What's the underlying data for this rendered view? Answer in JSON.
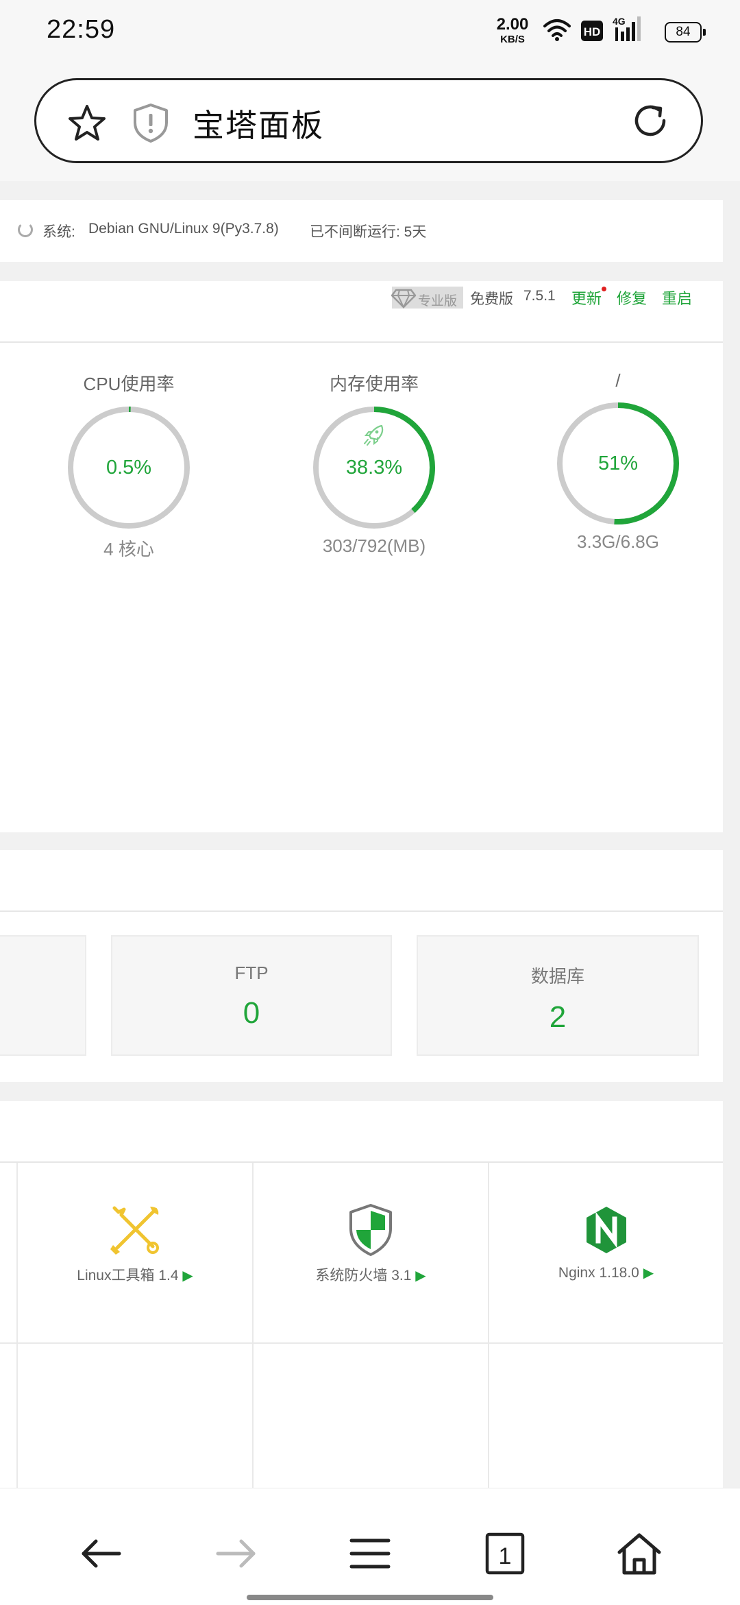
{
  "status_bar": {
    "time": "22:59",
    "net_speed_value": "2.00",
    "net_speed_unit": "KB/S",
    "hd_label": "HD",
    "signal_label": "4G",
    "battery": "84",
    "icons": [
      "wifi-icon",
      "hd-icon",
      "signal-icon",
      "battery-icon"
    ]
  },
  "address_bar": {
    "title": "宝塔面板",
    "icons": [
      "star-icon",
      "shield-alert-icon",
      "reload-icon"
    ]
  },
  "system_info": {
    "system_label": "系统:",
    "system_value": "Debian GNU/Linux 9(Py3.7.8)",
    "uptime": "已不间断运行: 5天"
  },
  "panel_header": {
    "pro_label": "专业版",
    "free_label": "免费版",
    "version": "7.5.1",
    "update": "更新",
    "repair": "修复",
    "restart": "重启"
  },
  "gauges": [
    {
      "label": "CPU使用率",
      "percent_text": "0.5%",
      "value": 0.5,
      "sub": "4 核心"
    },
    {
      "label": "内存使用率",
      "percent_text": "38.3%",
      "value": 38.3,
      "sub": "303/792(MB)"
    },
    {
      "label": "/",
      "percent_text": "51%",
      "value": 51,
      "sub": "3.3G/6.8G"
    }
  ],
  "overview": [
    {
      "label": "FTP",
      "value": "0"
    },
    {
      "label": "数据库",
      "value": "2"
    }
  ],
  "software": [
    {
      "name": "Linux工具箱 1.4",
      "icon": "tools-icon"
    },
    {
      "name": "系统防火墙 3.1",
      "icon": "firewall-shield-icon"
    },
    {
      "name": "Nginx 1.18.0",
      "icon": "nginx-icon"
    }
  ],
  "bottom_nav": {
    "tab_count": "1",
    "icons": [
      "back-arrow-icon",
      "forward-arrow-icon",
      "menu-icon",
      "tabs-icon",
      "home-icon"
    ]
  },
  "colors": {
    "accent": "#20a53a",
    "ring_track": "#cccccc",
    "update_dot": "#e02020"
  }
}
